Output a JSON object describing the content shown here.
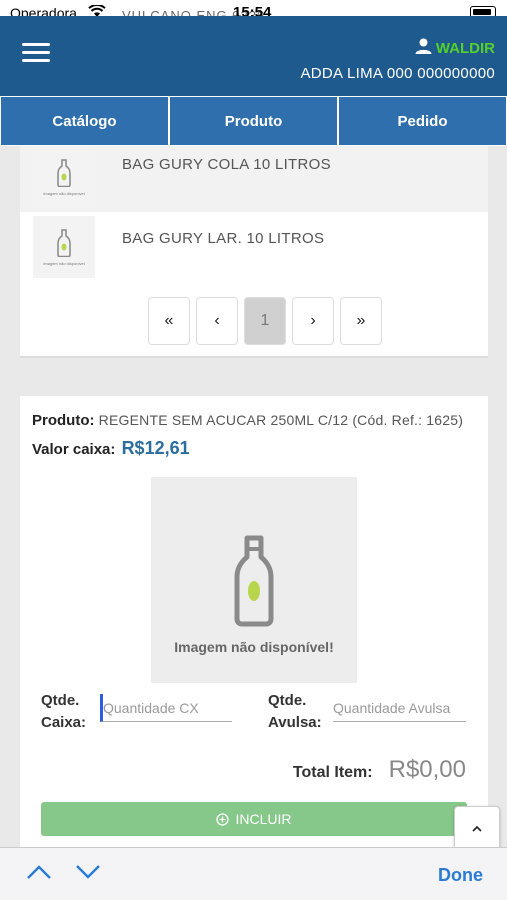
{
  "status_bar": {
    "carrier": "Operadora",
    "app": "VULCANO ENG 0226",
    "time": "15:54"
  },
  "header": {
    "user_name": "WALDIR",
    "user_subtitle": "ADDA LIMA 000 000000000"
  },
  "tabs": [
    {
      "label": "Catálogo"
    },
    {
      "label": "Produto"
    },
    {
      "label": "Pedido"
    }
  ],
  "product_list": {
    "items": [
      {
        "name": "BAG GURY COLA 10 LITROS",
        "thumb_caption": "Imagem não disponível"
      },
      {
        "name": "BAG GURY LAR. 10 LITROS",
        "thumb_caption": "Imagem não disponível"
      }
    ],
    "pagination": {
      "first": "«",
      "prev": "‹",
      "current": "1",
      "next": "›",
      "last": "»"
    }
  },
  "product_detail": {
    "product_label": "Produto:",
    "product_value": "REGENTE SEM ACUCAR 250ML C/12 (Cód. Ref.: 1625)",
    "price_label": "Valor caixa:",
    "price_value": "R$12,61",
    "image_caption": "Imagem não disponível!",
    "qty_box": {
      "label_line1": "Qtde.",
      "label_line2": "Caixa:",
      "placeholder": "Quantidade CX"
    },
    "qty_loose": {
      "label_line1": "Qtde.",
      "label_line2": "Avulsa:",
      "placeholder": "Quantidade Avulsa"
    },
    "total_label": "Total Item:",
    "total_value": "R$0,00",
    "add_button": "INCLUIR"
  },
  "keyboard_toolbar": {
    "done": "Done"
  },
  "colors": {
    "header": "#1f5a8e",
    "tab": "#2f6fad",
    "user_name": "#53d12b",
    "price": "#2b6d9c",
    "add_button": "#86c889",
    "done": "#2b7bd5"
  }
}
